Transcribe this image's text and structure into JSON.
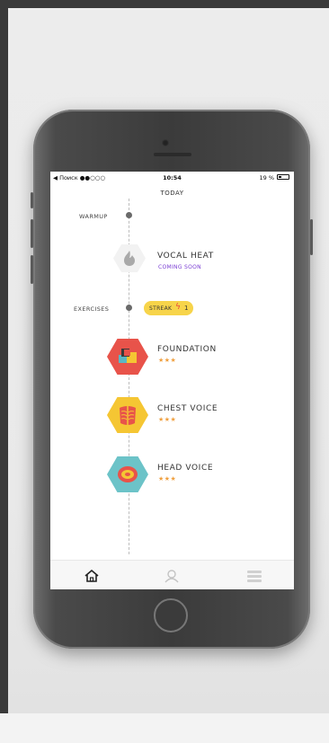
{
  "status_bar": {
    "carrier": "◀ Поиск ●●○○○",
    "time": "10:54",
    "battery_text": "19 %"
  },
  "header": {
    "title": "TODAY"
  },
  "sections": {
    "warmup_label": "WARMUP",
    "exercises_label": "EXERCISES"
  },
  "warmup_item": {
    "title": "VOCAL HEAT",
    "subtitle": "COMING SOON",
    "icon": "flame-icon"
  },
  "streak": {
    "label": "STREAK",
    "count": "1",
    "color": "#f7d44a"
  },
  "exercises": [
    {
      "title": "FOUNDATION",
      "stars": "★★★",
      "icon": "blocks-icon",
      "color": "#e8534a"
    },
    {
      "title": "CHEST VOICE",
      "stars": "★★★",
      "icon": "ribcage-icon",
      "color": "#f5c633"
    },
    {
      "title": "HEAD VOICE",
      "stars": "★★★",
      "icon": "brain-icon",
      "color": "#6cc3c8"
    }
  ],
  "tabs": [
    {
      "name": "home",
      "icon": "home-icon",
      "active": true
    },
    {
      "name": "profile",
      "icon": "user-icon",
      "active": false
    },
    {
      "name": "menu",
      "icon": "list-icon",
      "active": false
    }
  ],
  "colors": {
    "accent_purple": "#7b3fd4",
    "star": "#f0a040"
  }
}
